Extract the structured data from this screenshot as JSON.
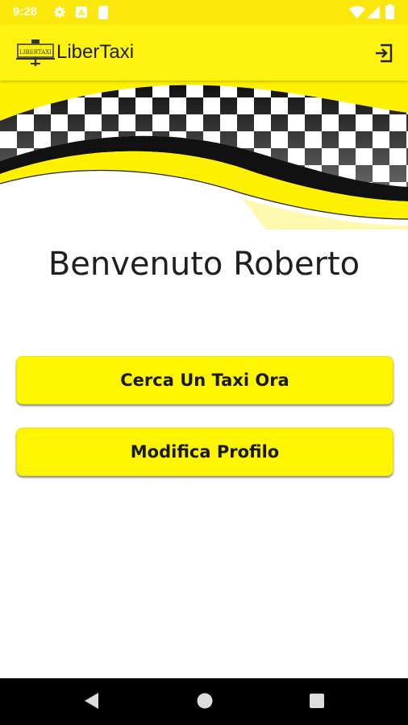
{
  "status_bar": {
    "time": "9:28",
    "icons": [
      "gear-icon",
      "translate-icon",
      "sd-card-icon",
      "wifi-icon",
      "signal-icon",
      "battery-icon"
    ]
  },
  "app_bar": {
    "logo_text": "LIBERTAXI",
    "title": "LiberTaxi",
    "logout_icon": "logout-icon"
  },
  "colors": {
    "status_bar": "#fbe80a",
    "app_bar": "#fef20f",
    "button": "#fef600",
    "banner_yellow": "#fef200"
  },
  "main": {
    "welcome": "Benvenuto Roberto",
    "buttons": {
      "search_taxi": "Cerca Un Taxi Ora",
      "edit_profile": "Modifica Profilo"
    }
  },
  "nav_bar": {
    "icons": [
      "back-icon",
      "home-icon",
      "recents-icon"
    ]
  }
}
